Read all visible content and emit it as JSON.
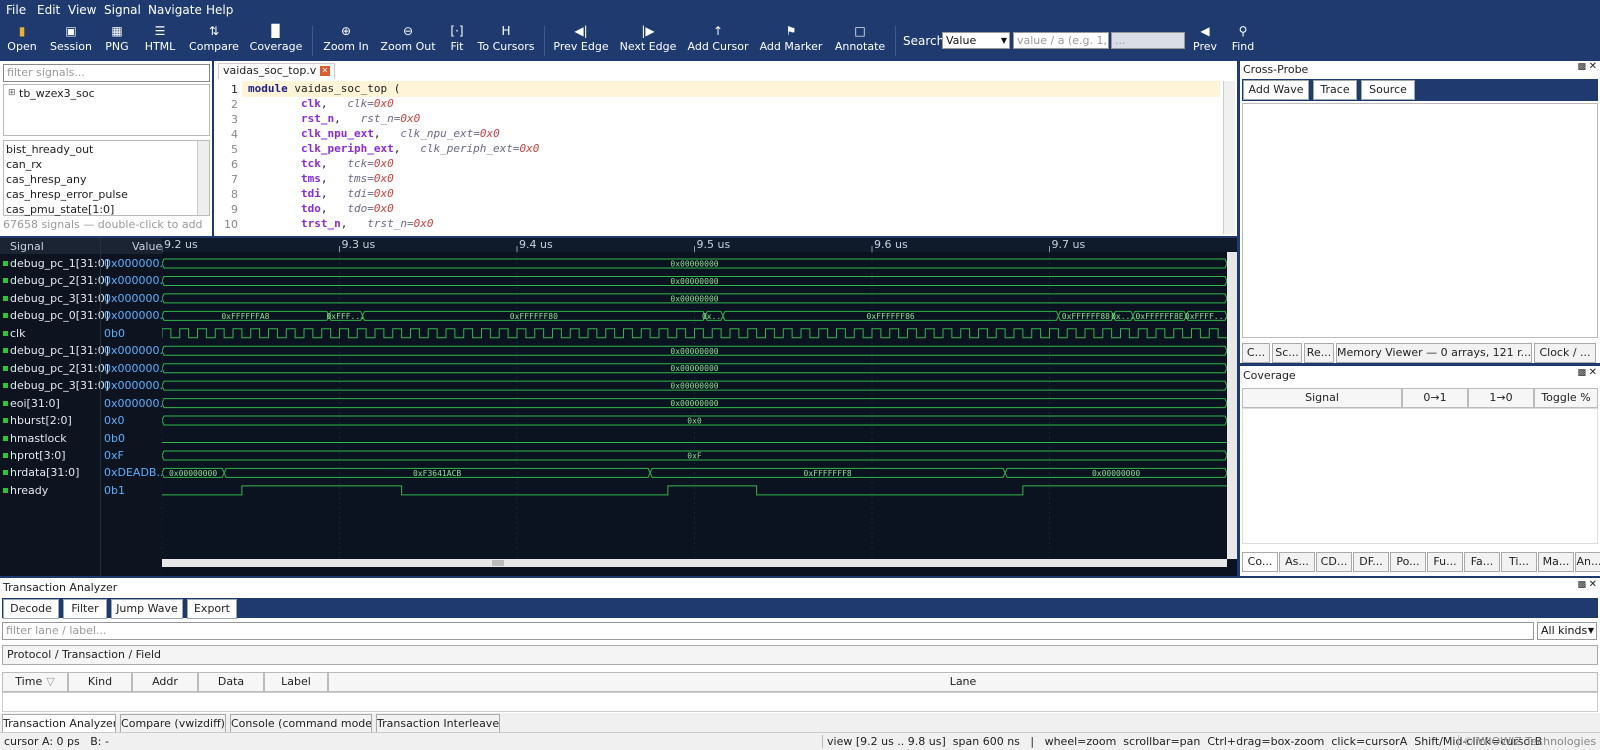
{
  "menu": [
    "File",
    "Edit",
    "View",
    "Signal",
    "Navigate",
    "Help"
  ],
  "toolbar": [
    {
      "label": "Open",
      "icon": "folder-icon"
    },
    {
      "label": "Session",
      "icon": "save-icon"
    },
    {
      "label": "PNG",
      "icon": "image-icon"
    },
    {
      "label": "HTML",
      "icon": "document-icon"
    },
    {
      "label": "Compare",
      "icon": "compare-icon"
    },
    {
      "label": "Coverage",
      "icon": "coverage-icon"
    },
    {
      "label": "Zoom In",
      "icon": "zoom-in-icon"
    },
    {
      "label": "Zoom Out",
      "icon": "zoom-out-icon"
    },
    {
      "label": "Fit",
      "icon": "fit-icon"
    },
    {
      "label": "To Cursors",
      "icon": "cursors-icon"
    },
    {
      "label": "Prev Edge",
      "icon": "prev-edge-icon"
    },
    {
      "label": "Next Edge",
      "icon": "next-edge-icon"
    },
    {
      "label": "Add Cursor",
      "icon": "cursor-icon"
    },
    {
      "label": "Add Marker",
      "icon": "flag-icon"
    },
    {
      "label": "Annotate",
      "icon": "comment-icon"
    },
    {
      "label": "Prev",
      "icon": "prev-icon"
    },
    {
      "label": "Find",
      "icon": "search-icon"
    }
  ],
  "search": {
    "label": "Search",
    "mode": "Value",
    "placeholder": "value / a (e.g. 1,...",
    "extra": "..."
  },
  "filter_signals": "filter signals...",
  "tree_root": "tb_wzex3_soc",
  "signal_list": [
    "bist_hready_out",
    "can_rx",
    "cas_hresp_any",
    "cas_hresp_error_pulse",
    "cas_pmu_state[1:0]"
  ],
  "signal_count": "67658 signals — double-click to add",
  "editor": {
    "tab": "vaidas_soc_top.v",
    "lines": [
      {
        "n": "1",
        "kw": "module",
        "name": "vaidas_soc_top",
        "rest": " ("
      },
      {
        "n": "2",
        "port": "clk",
        "cm": "clk=",
        "v": "0x0"
      },
      {
        "n": "3",
        "port": "rst_n",
        "cm": "rst_n=",
        "v": "0x0"
      },
      {
        "n": "4",
        "port": "clk_npu_ext",
        "cm": "clk_npu_ext=",
        "v": "0x0"
      },
      {
        "n": "5",
        "port": "clk_periph_ext",
        "cm": "clk_periph_ext=",
        "v": "0x0"
      },
      {
        "n": "6",
        "port": "tck",
        "cm": "tck=",
        "v": "0x0"
      },
      {
        "n": "7",
        "port": "tms",
        "cm": "tms=",
        "v": "0x0"
      },
      {
        "n": "8",
        "port": "tdi",
        "cm": "tdi=",
        "v": "0x0"
      },
      {
        "n": "9",
        "port": "tdo",
        "cm": "tdo=",
        "v": "0x0"
      },
      {
        "n": "10",
        "port": "trst_n",
        "cm": "trst_n=",
        "v": "0x0"
      }
    ]
  },
  "xprobe": {
    "title": "Cross-Probe",
    "buttons": [
      "Add Wave",
      "Trace",
      "Source"
    ],
    "tabs": [
      "C...",
      "Sc...",
      "Re...",
      "Memory Viewer — 0 arrays, 121 r...",
      "Clock / ..."
    ]
  },
  "coverage": {
    "title": "Coverage",
    "cols": [
      "Signal",
      "0→1",
      "1→0",
      "Toggle %"
    ],
    "tabs": [
      "Co...",
      "As...",
      "CD...",
      "DF...",
      "Po...",
      "Fu...",
      "Fa...",
      "Ti...",
      "Ma...",
      "An..."
    ]
  },
  "wave": {
    "hdr_signal": "Signal",
    "hdr_value": "Value",
    "time_start_us": 9.2,
    "time_end_us": 9.8,
    "ticks": [
      "9.2 us",
      "9.3 us",
      "9.4 us",
      "9.5 us",
      "9.6 us",
      "9.7 us"
    ],
    "rows": [
      {
        "name": "debug_pc_1[31:0]",
        "value": "0x000000...",
        "kind": "bus",
        "segs": [
          {
            "s": 9.2,
            "e": 9.8,
            "t": "0x00000000"
          }
        ]
      },
      {
        "name": "debug_pc_2[31:0]",
        "value": "0x000000...",
        "kind": "bus",
        "segs": [
          {
            "s": 9.2,
            "e": 9.8,
            "t": "0x00000000"
          }
        ]
      },
      {
        "name": "debug_pc_3[31:0]",
        "value": "0x000000...",
        "kind": "bus",
        "segs": [
          {
            "s": 9.2,
            "e": 9.8,
            "t": "0x00000000"
          }
        ]
      },
      {
        "name": "debug_pc_0[31:0]",
        "value": "0x000000...",
        "kind": "bus",
        "segs": [
          {
            "s": 9.2,
            "e": 9.294,
            "t": "0xFFFFFFA8"
          },
          {
            "s": 9.294,
            "e": 9.313,
            "t": "0xFFF..."
          },
          {
            "s": 9.313,
            "e": 9.506,
            "t": "0xFFFFFF80"
          },
          {
            "s": 9.506,
            "e": 9.516,
            "t": "0x..."
          },
          {
            "s": 9.516,
            "e": 9.705,
            "t": "0xFFFFFF86"
          },
          {
            "s": 9.705,
            "e": 9.736,
            "t": "0xFFFFFF88"
          },
          {
            "s": 9.736,
            "e": 9.747,
            "t": "0x..."
          },
          {
            "s": 9.747,
            "e": 9.777,
            "t": "0xFFFFFF8E"
          },
          {
            "s": 9.777,
            "e": 9.8,
            "t": "0xFFFF..."
          }
        ]
      },
      {
        "name": "clk",
        "value": "0b0",
        "kind": "clock",
        "period_ns": 10
      },
      {
        "name": "debug_pc_1[31:0]",
        "value": "0x000000...",
        "kind": "bus",
        "segs": [
          {
            "s": 9.2,
            "e": 9.8,
            "t": "0x00000000"
          }
        ]
      },
      {
        "name": "debug_pc_2[31:0]",
        "value": "0x000000...",
        "kind": "bus",
        "segs": [
          {
            "s": 9.2,
            "e": 9.8,
            "t": "0x00000000"
          }
        ]
      },
      {
        "name": "debug_pc_3[31:0]",
        "value": "0x000000...",
        "kind": "bus",
        "segs": [
          {
            "s": 9.2,
            "e": 9.8,
            "t": "0x00000000"
          }
        ]
      },
      {
        "name": "eoi[31:0]",
        "value": "0x000000...",
        "kind": "bus",
        "segs": [
          {
            "s": 9.2,
            "e": 9.8,
            "t": "0x00000000"
          }
        ]
      },
      {
        "name": "hburst[2:0]",
        "value": "0x0",
        "kind": "bus",
        "segs": [
          {
            "s": 9.2,
            "e": 9.8,
            "t": "0x0"
          }
        ]
      },
      {
        "name": "hmastlock",
        "value": "0b0",
        "kind": "bit",
        "edges": []
      },
      {
        "name": "hprot[3:0]",
        "value": "0xF",
        "kind": "bus",
        "segs": [
          {
            "s": 9.2,
            "e": 9.8,
            "t": "0xF"
          }
        ]
      },
      {
        "name": "hrdata[31:0]",
        "value": "0xDEADB...",
        "kind": "bus",
        "segs": [
          {
            "s": 9.2,
            "e": 9.235,
            "t": "0x00000000"
          },
          {
            "s": 9.235,
            "e": 9.475,
            "t": "0xF3641ACB"
          },
          {
            "s": 9.475,
            "e": 9.675,
            "t": "0xFFFFFFF8"
          },
          {
            "s": 9.675,
            "e": 9.8,
            "t": "0x00000000"
          }
        ]
      },
      {
        "name": "hready",
        "value": "0b1",
        "kind": "bit",
        "init": 0,
        "edges": [
          9.245,
          9.335,
          9.485,
          9.535,
          9.685
        ]
      }
    ]
  },
  "txa": {
    "title": "Transaction Analyzer",
    "buttons": [
      "Decode",
      "Filter",
      "Jump Wave",
      "Export"
    ],
    "filter_placeholder": "filter lane / label...",
    "kinds": "All kinds",
    "tree_header": "Protocol / Transaction / Field",
    "cols": [
      "Time",
      "Kind",
      "Addr",
      "Data",
      "Label",
      "Lane"
    ]
  },
  "bottom_tabs": [
    "Transaction Analyzer",
    "Compare (vwizdiff)",
    "Console (command mode)",
    "Transaction Interleave"
  ],
  "status": {
    "cursor": "cursor A: 0 ps   B: -",
    "hint": "view [9.2 us .. 9.8 us]  span 600 ns   |   wheel=zoom  scrollbar=pan  Ctrl+drag=box-zoom  click=cursorA  Shift/Mid-click=cursorB",
    "brand": "© WIOWIZ Technologies"
  }
}
